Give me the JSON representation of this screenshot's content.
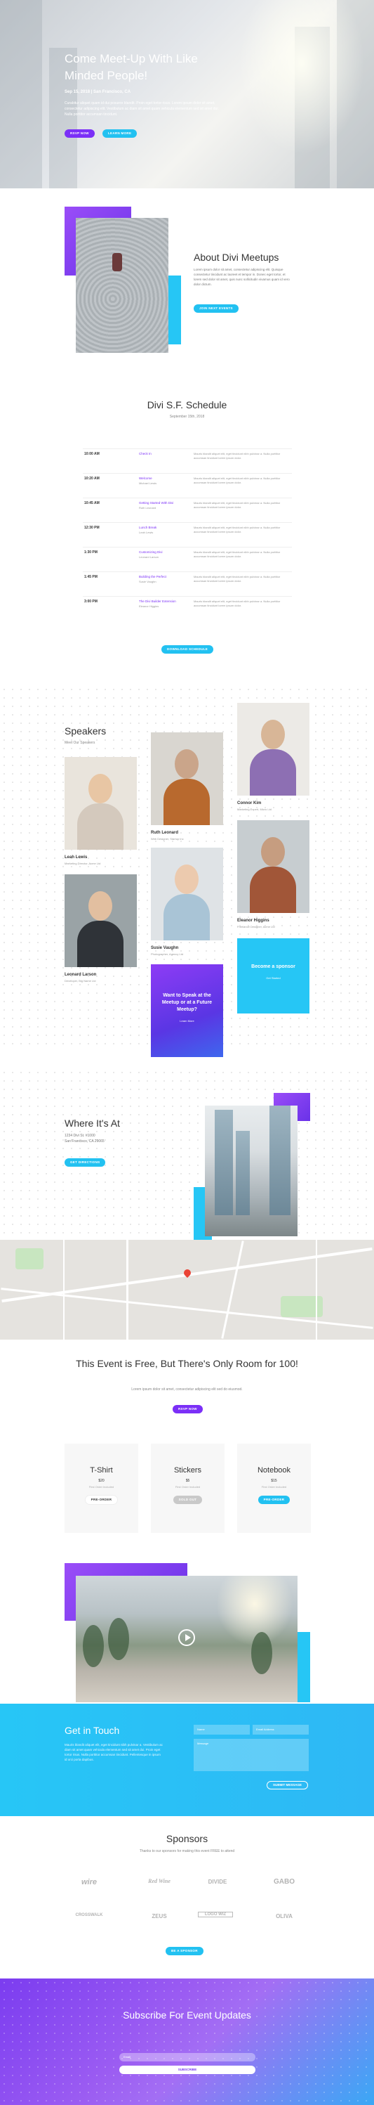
{
  "hero": {
    "title": "Come Meet-Up With Like Minded People!",
    "meta": "Sep 15, 2018 | San Francisco, CA",
    "description": "Curabitur aliquet quam id dui posuere blandit. Proin eget tortor risus. Lorem ipsum dolor sit amet, consectetur adipiscing elit. Vestibulum ac diam sit amet quam vehicula elementum sed sit amet dui. Nulla porttitor accumsan tincidunt.",
    "rsvp_label": "RSVP NOW",
    "learn_label": "LEARN MORE"
  },
  "about": {
    "title": "About Divi Meetups",
    "text": "Lorem ipsum dolor sit amet, consectetur adipiscing elit. Quisque consectetur tincidunt ac laoreet et tempor in. Donec eget tortor, et lorem sed dolor sit amet, quis nunc sollicitudin vivamus quam id vero dolor dictum.",
    "button": "JOIN NEXT EVENTS"
  },
  "schedule": {
    "title": "Divi S.F. Schedule",
    "date": "September 15th, 2018",
    "button": "DOWNLOAD SCHEDULE",
    "rows": [
      {
        "time": "10:00 AM",
        "session": "Check In",
        "speaker": "",
        "desc": "Mauris blandit aliquet elit, eget tincidunt nibh pulvinar a. Nulla porttitor accumsan tincidunt lorem ipsum dolor."
      },
      {
        "time": "10:20 AM",
        "session": "Welcome",
        "speaker": "Michael Lewis",
        "desc": "Mauris blandit aliquet elit, eget tincidunt nibh pulvinar a. Nulla porttitor accumsan tincidunt lorem ipsum dolor."
      },
      {
        "time": "10:45 AM",
        "session": "Getting Started With Divi",
        "speaker": "Ruth Leonard",
        "desc": "Mauris blandit aliquet elit, eget tincidunt nibh pulvinar a. Nulla porttitor accumsan tincidunt lorem ipsum dolor."
      },
      {
        "time": "12:30 PM",
        "session": "Lunch Break",
        "speaker": "Leah Lewis",
        "desc": "Mauris blandit aliquet elit, eget tincidunt nibh pulvinar a. Nulla porttitor accumsan tincidunt lorem ipsum dolor."
      },
      {
        "time": "1:30 PM",
        "session": "Customizing Divi",
        "speaker": "Leonard Larson",
        "desc": "Mauris blandit aliquet elit, eget tincidunt nibh pulvinar a. Nulla porttitor accumsan tincidunt lorem ipsum dolor."
      },
      {
        "time": "1:45 PM",
        "session": "Building the Perfect",
        "speaker": "Susie Vaughn",
        "desc": "Mauris blandit aliquet elit, eget tincidunt nibh pulvinar a. Nulla porttitor accumsan tincidunt lorem ipsum dolor."
      },
      {
        "time": "3:00 PM",
        "session": "The Divi Builder Extension",
        "speaker": "Eleanor Higgins",
        "desc": "Mauris blandit aliquet elit, eget tincidunt nibh pulvinar a. Nulla porttitor accumsan tincidunt lorem ipsum dolor."
      }
    ]
  },
  "speakers": {
    "title": "Speakers",
    "subtitle": "Meet Our Speakers",
    "people": [
      {
        "name": "Leah Lewis",
        "role": "Marketing Director, Acme Ltd"
      },
      {
        "name": "Ruth Leonard",
        "role": "Web Designer, Startup Inc"
      },
      {
        "name": "Connor Kim",
        "role": "Marketing Expert, Micro Ltd"
      },
      {
        "name": "Leonard Larson",
        "role": "Developer, Big Name Ltd"
      },
      {
        "name": "Susie Vaughn",
        "role": "Photographer, Agency Ltd"
      },
      {
        "name": "Eleanor Higgins",
        "role": "Freelance Designer, Acme Ltd"
      }
    ],
    "cta_speak": {
      "title": "Want to Speak at the Meetup or at a Future Meetup?",
      "link": "Learn More"
    },
    "cta_sponsor": {
      "title": "Become a sponsor",
      "link": "Get Started"
    }
  },
  "where": {
    "title": "Where It's At",
    "address1": "1234 Divi St. #1000",
    "address2": "San Francisco, CA 29065",
    "button": "GET DIRECTIONS"
  },
  "free": {
    "title": "This Event is Free, But There's Only Room for 100!",
    "subtitle": "Lorem ipsum dolor sit amet, consectetur adipiscing elit sed do eiusmod.",
    "button": "RSVP NOW",
    "items": [
      {
        "name": "T-Shirt",
        "price": "$20",
        "note": "First Order Included",
        "button": "PRE-ORDER"
      },
      {
        "name": "Stickers",
        "price": "$5",
        "note": "First Order Included",
        "button": "SOLD OUT"
      },
      {
        "name": "Notebook",
        "price": "$15",
        "note": "First Order Included",
        "button": "PRE-ORDER"
      }
    ]
  },
  "contact": {
    "title": "Get in Touch",
    "text": "Mauris blandit aliquet elit, eget tincidunt nibh pulvinar a. Vestibulum ac diam sit amet quam vehicula elementum sed sit amet dui. Proin eget tortor risus. Nulla porttitor accumsan tincidunt. Pellentesque in ipsum id orci porta dapibus.",
    "name_placeholder": "Name",
    "email_placeholder": "Email Address",
    "message_placeholder": "Message",
    "submit": "SUBMIT MESSAGE"
  },
  "sponsors": {
    "title": "Sponsors",
    "subtitle": "Thanks to our sponsors for making this event FREE to attend",
    "logos_row1": [
      "wire",
      "Red Wine",
      "DIVIDE",
      "GABO"
    ],
    "logos_row2": [
      "CROSSWALK",
      "ZEUS",
      "LOGO WIZ",
      "OLIVA"
    ],
    "button": "BE A SPONSOR"
  },
  "subscribe": {
    "title": "Subscribe For Event Updates",
    "email_placeholder": "Email",
    "button": "SUBSCRIBE"
  },
  "colors": {
    "purple": "#7b2ff7",
    "blue": "#22c1f1"
  }
}
